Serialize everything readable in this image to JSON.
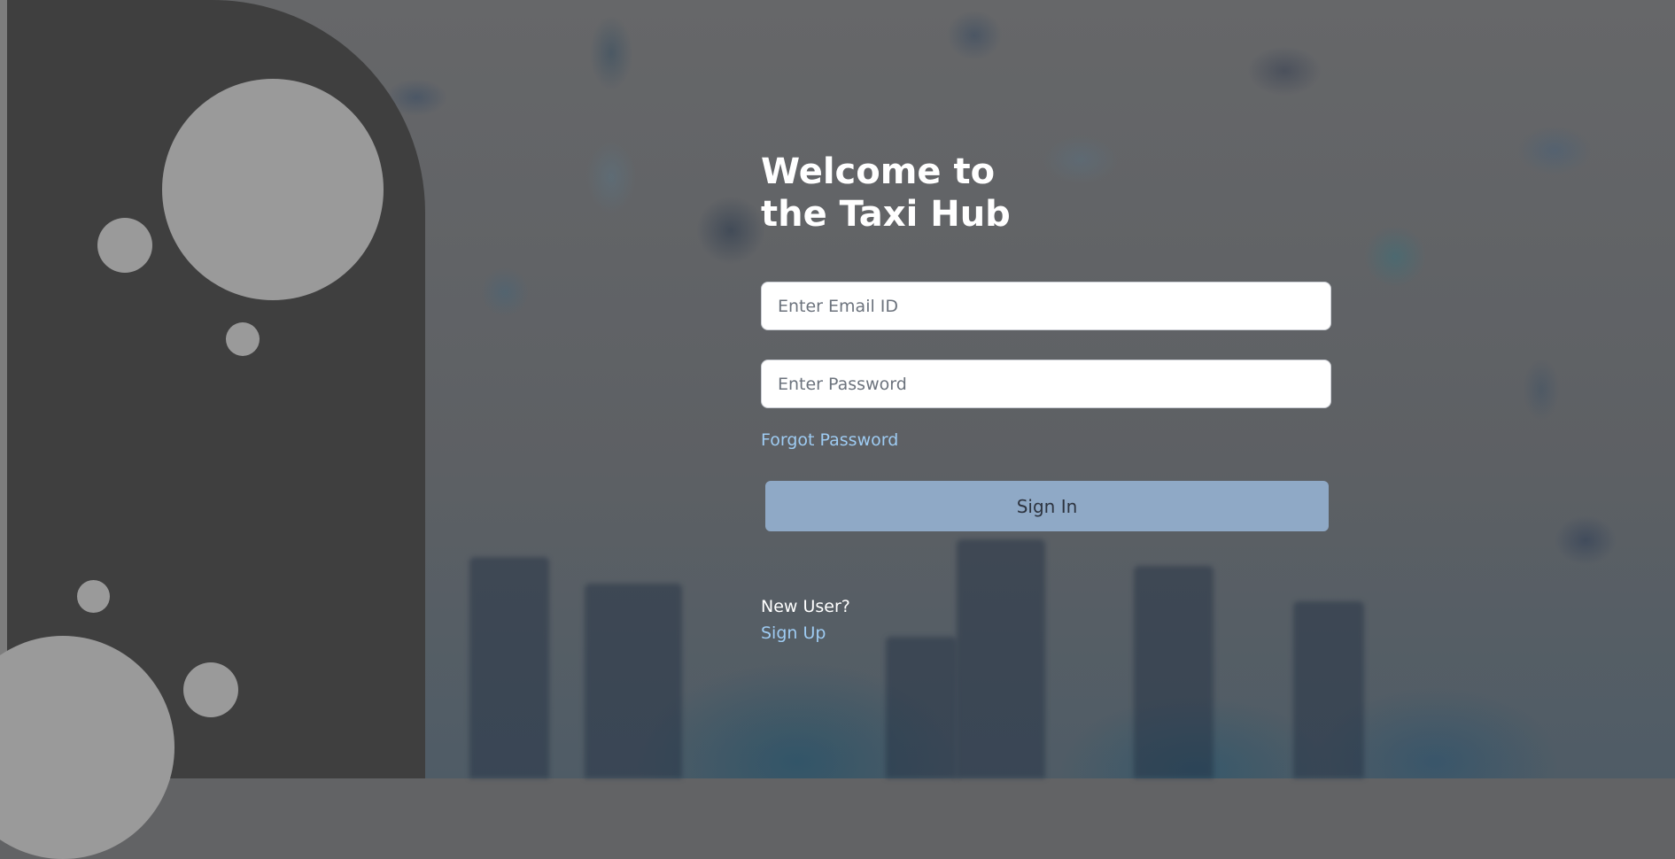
{
  "login": {
    "title_line1": "Welcome to",
    "title_line2": "the Taxi Hub",
    "email_placeholder": "Enter Email ID",
    "password_placeholder": "Enter Password",
    "forgot_password": "Forgot Password",
    "sign_in": "Sign In",
    "new_user": "New User?",
    "sign_up": "Sign Up"
  },
  "colors": {
    "link": "#9ecbf2",
    "button": "#8fa9c6",
    "panel": "#3f3f3f",
    "bubble": "#9a9a9a"
  }
}
